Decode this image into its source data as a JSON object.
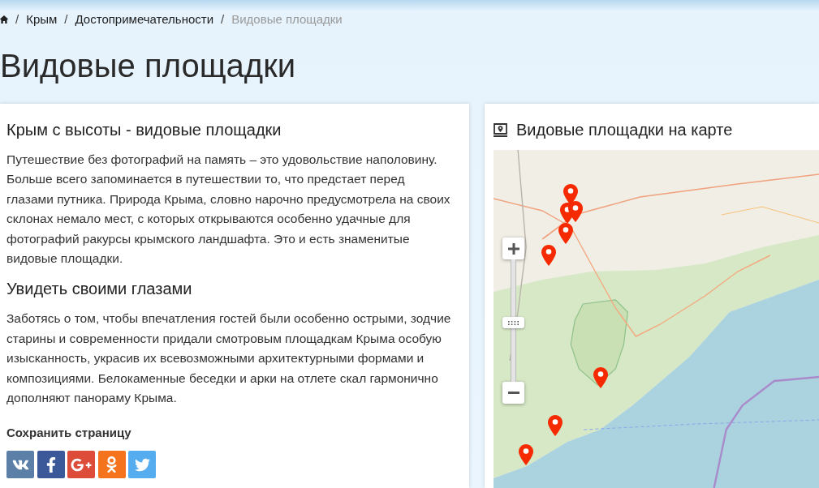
{
  "breadcrumb": {
    "items": [
      {
        "separator": "/",
        "label": "Крым",
        "current": false
      },
      {
        "separator": "/",
        "label": "Достопримечательности",
        "current": false
      },
      {
        "separator": "/",
        "label": "Видовые площадки",
        "current": true
      }
    ]
  },
  "page_title": "Видовые площадки",
  "article": {
    "sections": [
      {
        "heading": "Крым с высоты - видовые площадки",
        "text": "Путешествие без фотографий на память – это удовольствие наполовину. Больше всего запоминается в путешествии то, что предстает перед глазами путника. Природа Крыма, словно нарочно предусмотрела на своих склонах немало мест, с которых открываются особенно удачные для фотографий ракурсы крымского ландшафта. Это и есть знаменитые видовые площадки."
      },
      {
        "heading": "Увидеть своими глазами",
        "text": "Заботясь о том, чтобы впечатления гостей были особенно острыми, зодчие старины и современности придали смотровым площадкам Крыма особую изысканность, украсив их всевозможными архитектурными формами и композициями. Белокаменные беседки и арки на отлете скал гармонично дополняют панораму Крыма."
      }
    ],
    "share": {
      "label": "Сохранить страницу",
      "buttons": [
        {
          "kind": "vk"
        },
        {
          "kind": "facebook"
        },
        {
          "kind": "google_plus"
        },
        {
          "kind": "odnoklassniki"
        },
        {
          "kind": "twitter"
        }
      ]
    }
  },
  "map": {
    "title": "Видовые площадки на карте",
    "zoom_slider": {
      "level": 0.48
    }
  }
}
